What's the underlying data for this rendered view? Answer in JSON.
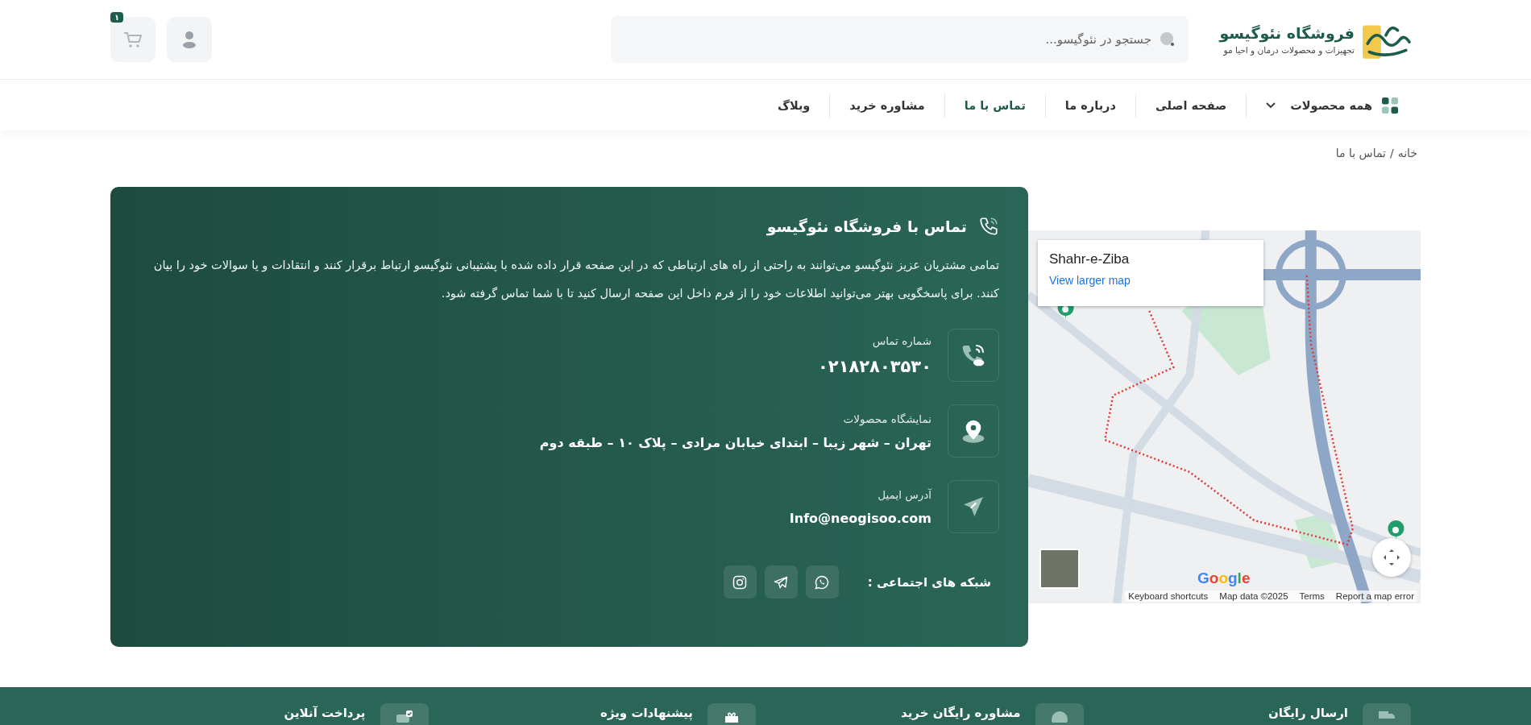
{
  "header": {
    "logo": {
      "title": "فروشگاه نئوگیسو",
      "subtitle": "تجهیزات و محصولات درمان و احیا مو"
    },
    "search": {
      "placeholder": "جستجو در نئوگیسو..."
    },
    "cart_count": "۱"
  },
  "nav": [
    {
      "label": "همه محصولات",
      "kind": "dropdown",
      "selected": false
    },
    {
      "label": "صفحه اصلی",
      "kind": "link",
      "selected": false
    },
    {
      "label": "درباره ما",
      "kind": "link",
      "selected": false
    },
    {
      "label": "تماس با ما",
      "kind": "link",
      "selected": true
    },
    {
      "label": "مشاوره خرید",
      "kind": "link",
      "selected": false
    },
    {
      "label": "وبلاگ",
      "kind": "link",
      "selected": false
    }
  ],
  "breadcrumb": {
    "items": [
      "خانه",
      "تماس با ما"
    ],
    "separator": "/"
  },
  "contact": {
    "title": "تماس با فروشگاه نئوگیسو",
    "intro": "تمامی مشتریان عزیز نئوگیسو می‌توانند به راحتی از راه های ارتباطی که در این صفحه قرار داده شده با پشتیبانی نئوگیسو ارتباط برقرار کنند و انتقادات و یا سوالات خود را بیان کنند. برای پاسخگویی بهتر می‌توانید اطلاعات خود را از فرم داخل این صفحه ارسال کنید تا با شما تماس گرفته شود.",
    "items": [
      {
        "kind": "phone",
        "label": "شماره تماس",
        "value": "۰۲۱۸۲۸۰۳۵۳۰"
      },
      {
        "kind": "address",
        "label": "نمایشگاه محصولات",
        "value": "تهران – شهر زیبا – ابتدای خیابان مرادی – پلاک ۱۰ – طبقه دوم"
      },
      {
        "kind": "email",
        "label": "آدرس ایمیل",
        "value": "Info@neogisoo.com"
      }
    ],
    "social_label": "شبکه های اجتماعی :"
  },
  "map": {
    "place": "Shahr-e-Ziba",
    "link": "View larger map",
    "logo": "Google",
    "attribution": [
      "Report a map error",
      "Terms",
      "Map data ©2025",
      "Keyboard shortcuts"
    ]
  },
  "features": [
    {
      "kind": "shipping",
      "label": "ارسال رایگان"
    },
    {
      "kind": "consult",
      "label": "مشاوره رایگان خرید"
    },
    {
      "kind": "offers",
      "label": "پیشنهادات ویژه"
    },
    {
      "kind": "payment",
      "label": "پرداخت آنلاین"
    }
  ]
}
